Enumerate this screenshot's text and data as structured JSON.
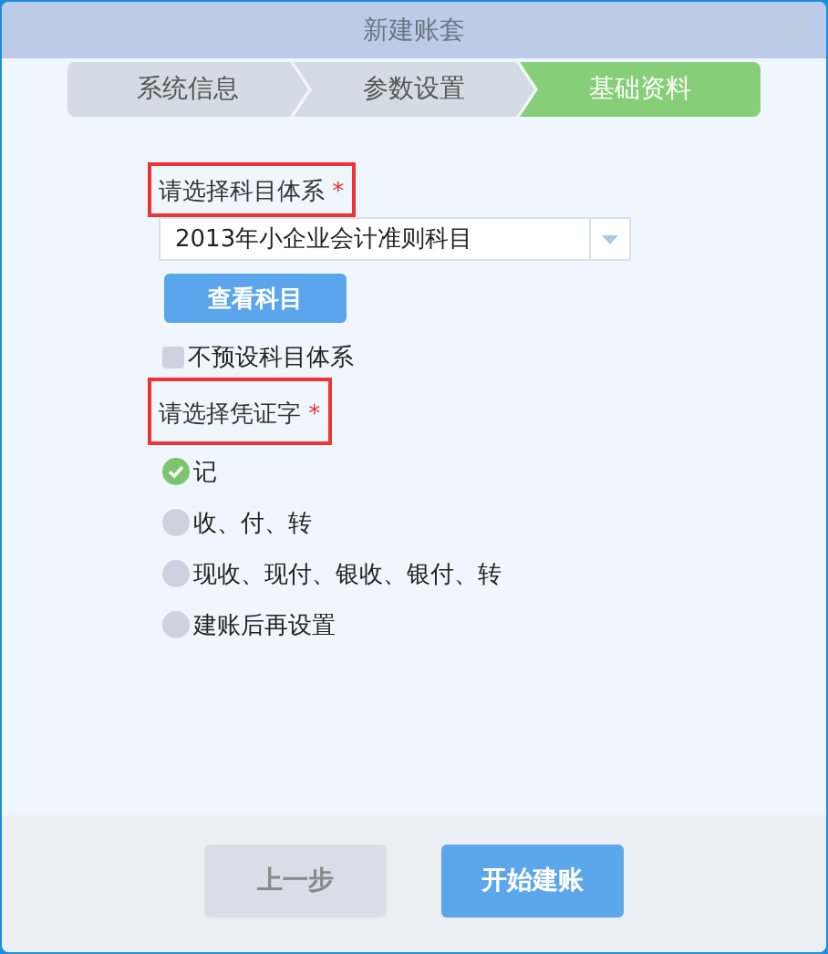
{
  "window": {
    "title": "新建账套"
  },
  "steps": [
    {
      "label": "系统信息",
      "selected": false
    },
    {
      "label": "参数设置",
      "selected": false
    },
    {
      "label": "基础资料",
      "selected": true
    }
  ],
  "subject_system": {
    "label": "请选择科目体系",
    "required_mark": "*",
    "highlighted": true,
    "value": "2013年小企业会计准则科目",
    "view_button": "查看科目",
    "no_preset": {
      "label": "不预设科目体系",
      "checked": false
    }
  },
  "voucher": {
    "label": "请选择凭证字",
    "required_mark": "*",
    "highlighted": true,
    "options": [
      {
        "label": "记",
        "selected": true
      },
      {
        "label": "收、付、转",
        "selected": false
      },
      {
        "label": "现收、现付、银收、银付、转",
        "selected": false
      },
      {
        "label": "建账后再设置",
        "selected": false
      }
    ]
  },
  "buttons": [
    {
      "label": "上一步",
      "kind": "secondary"
    },
    {
      "label": "开始建账",
      "kind": "primary"
    }
  ]
}
